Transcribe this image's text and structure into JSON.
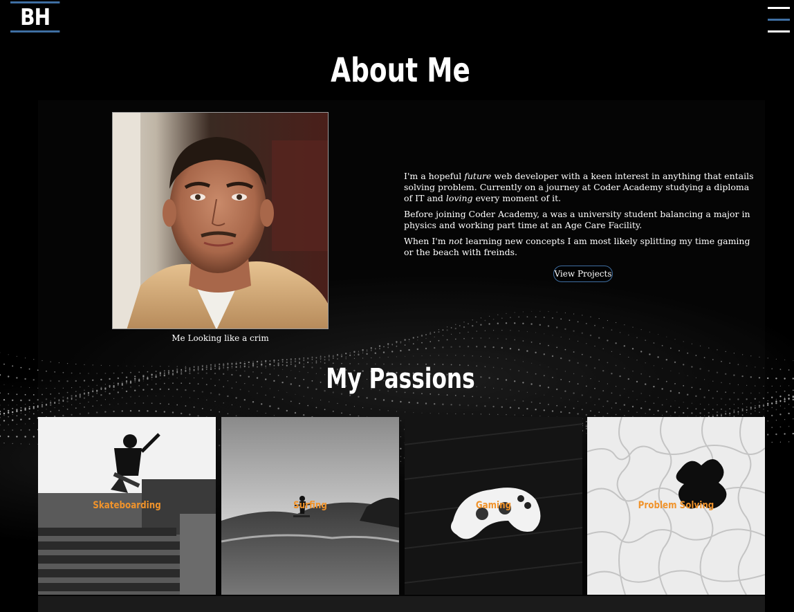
{
  "header": {
    "logo_text": "BH",
    "menu_icon": "hamburger-menu-icon"
  },
  "about": {
    "title": "About Me",
    "portrait_caption": "Me Looking like a crim",
    "bio": {
      "p1_a": "I'm a hopeful ",
      "p1_em1": "future",
      "p1_b": " web developer with a keen interest in anything that entails solving problem. Currently on a journey at Coder Academy studying a diploma of IT and ",
      "p1_em2": "loving",
      "p1_c": " every moment of it.",
      "p2": "Before joining Coder Academy, a was a university student balancing a major in physics and working part time at an Age Care Facility.",
      "p3_a": "When I'm ",
      "p3_em": "not",
      "p3_b": " learning new concepts I am most likely splitting my time gaming or the beach with freinds."
    },
    "view_projects_label": "View Projects"
  },
  "passions": {
    "title": "My Passions",
    "items": [
      {
        "label": "Skateboarding"
      },
      {
        "label": "Surfing"
      },
      {
        "label": "Gaming"
      },
      {
        "label": "Problem Solving"
      }
    ]
  },
  "colors": {
    "accent_blue": "#3f6fa3",
    "passion_label": "#f0932b",
    "background": "#000000"
  }
}
